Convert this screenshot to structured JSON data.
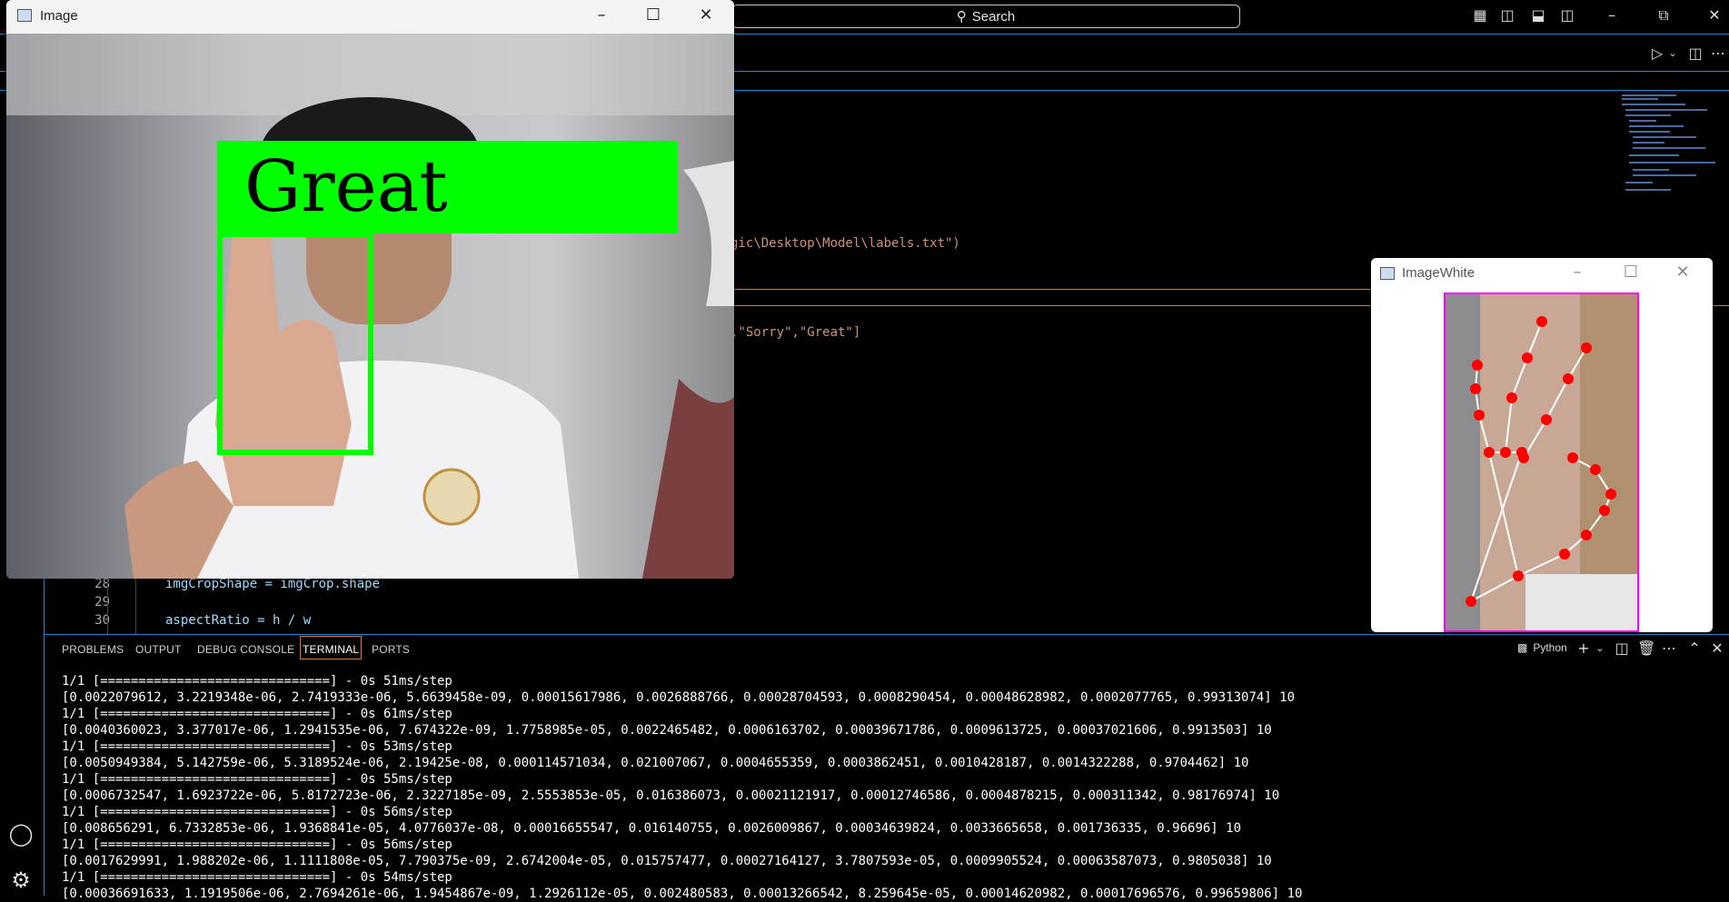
{
  "vscode": {
    "search_label": "Search",
    "code_fragments": {
      "path_line": "gic\\Desktop\\Model\\labels.txt\")",
      "labels_line": ",\"Sorry\",\"Great\"]"
    },
    "code_lines": [
      {
        "number": "28",
        "text": "imgCropShape = imgCrop.shape"
      },
      {
        "number": "29",
        "text": ""
      },
      {
        "number": "30",
        "text": "aspectRatio = h / w"
      }
    ],
    "panel_tabs": [
      "PROBLEMS",
      "OUTPUT",
      "DEBUG CONSOLE",
      "TERMINAL",
      "PORTS"
    ],
    "active_panel_tab": "TERMINAL",
    "terminal_shell": "Python",
    "terminal_lines": [
      "1/1 [==============================] - 0s 51ms/step",
      "[0.0022079612, 3.2219348e-06, 2.7419333e-06, 5.6639458e-09, 0.00015617986, 0.0026888766, 0.00028704593, 0.0008290454, 0.00048628982, 0.0002077765, 0.99313074] 10",
      "1/1 [==============================] - 0s 61ms/step",
      "[0.0040360023, 3.377017e-06, 1.2941535e-06, 7.674322e-09, 1.7758985e-05, 0.0022465482, 0.0006163702, 0.00039671786, 0.0009613725, 0.00037021606, 0.9913503] 10",
      "1/1 [==============================] - 0s 53ms/step",
      "[0.0050949384, 5.142759e-06, 5.3189524e-06, 2.19425e-08, 0.000114571034, 0.021007067, 0.0004655359, 0.0003862451, 0.0010428187, 0.0014322288, 0.9704462] 10",
      "1/1 [==============================] - 0s 55ms/step",
      "[0.0006732547, 1.6923722e-06, 5.8172723e-06, 2.3227185e-09, 2.5553853e-05, 0.016386073, 0.00021121917, 0.00012746586, 0.0004878215, 0.000311342, 0.98176974] 10",
      "1/1 [==============================] - 0s 56ms/step",
      "[0.008656291, 6.7332853e-06, 1.9368841e-05, 4.0776037e-08, 0.00016655547, 0.016140755, 0.0026009867, 0.00034639824, 0.0033665658, 0.001736335, 0.96696] 10",
      "1/1 [==============================] - 0s 56ms/step",
      "[0.0017629991, 1.988202e-06, 1.1111808e-05, 7.790375e-09, 2.6742004e-05, 0.015757477, 0.00027164127, 3.7807593e-05, 0.0009905524, 0.00063587073, 0.9805038] 10",
      "1/1 [==============================] - 0s 54ms/step",
      "[0.00036691633, 1.1919506e-06, 2.7694261e-06, 1.9454867e-09, 1.2926112e-05, 0.002480583, 0.00013266542, 8.259645e-05, 0.00014620982, 0.00017696576, 0.99659806] 10"
    ]
  },
  "image_window": {
    "title": "Image",
    "prediction_label": "Great"
  },
  "imagewhite_window": {
    "title": "ImageWhite"
  },
  "colors": {
    "label_bg": "#00ff00",
    "hand_box": "#00ff00",
    "crop_border": "#ff00ff",
    "landmark": "#ff0000",
    "accent": "#1f8ad2"
  }
}
